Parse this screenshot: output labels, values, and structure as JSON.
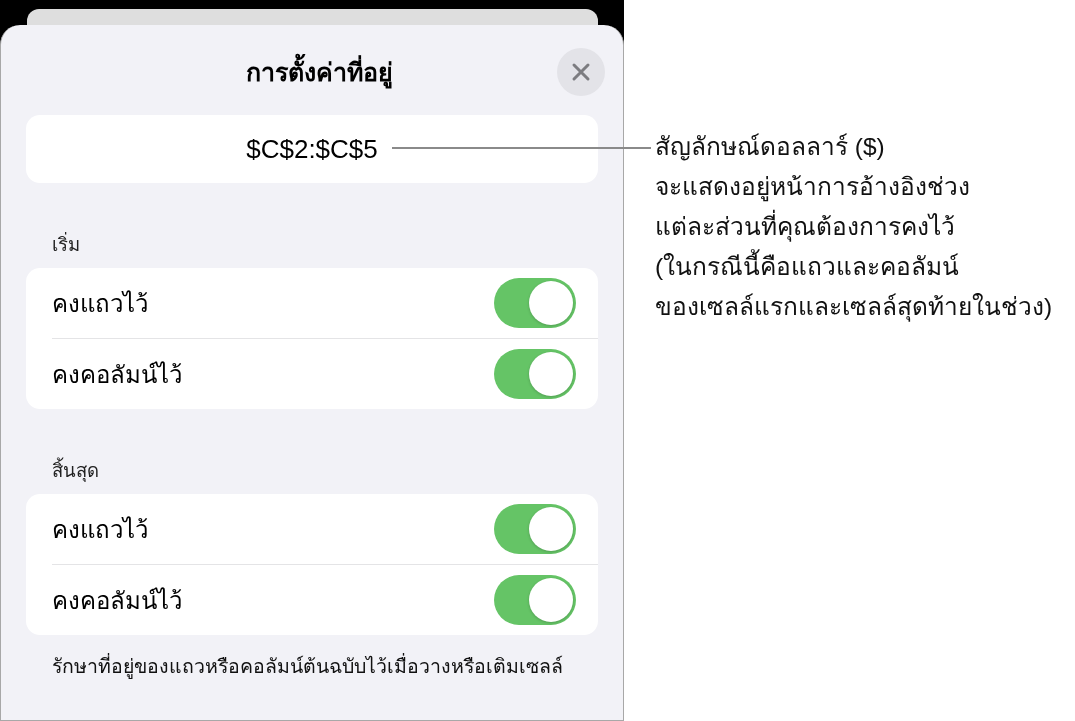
{
  "sheet": {
    "title": "การตั้งค่าที่อยู่",
    "address_field": {
      "value": "$C$2:$C$5"
    },
    "sections": [
      {
        "header": "เริ่ม",
        "rows": [
          {
            "label": "คงแถวไว้",
            "on": true
          },
          {
            "label": "คงคอลัมน์ไว้",
            "on": true
          }
        ]
      },
      {
        "header": "สิ้นสุด",
        "rows": [
          {
            "label": "คงแถวไว้",
            "on": true
          },
          {
            "label": "คงคอลัมน์ไว้",
            "on": true
          }
        ]
      }
    ],
    "footer": "รักษาที่อยู่ของแถวหรือคอลัมน์ต้นฉบับไว้เมื่อวางหรือเติมเซลล์"
  },
  "callout": {
    "lines": [
      "สัญลักษณ์ดอลลาร์ ($)",
      "จะแสดงอยู่หน้าการอ้างอิงช่วง",
      "แต่ละส่วนที่คุณต้องการคงไว้",
      "(ในกรณีนี้คือแถวและคอลัมน์",
      "ของเซลล์แรกและเซลล์สุดท้ายในช่วง)"
    ]
  }
}
